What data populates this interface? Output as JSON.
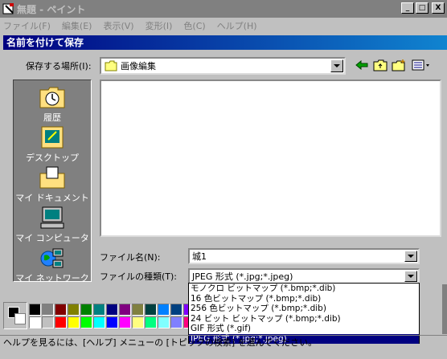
{
  "window": {
    "title": "無題 - ペイント",
    "controls": {
      "minimize": "_",
      "maximize": "□",
      "close": "X"
    }
  },
  "menu": [
    "ファイル(F)",
    "編集(E)",
    "表示(V)",
    "変形(I)",
    "色(C)",
    "ヘルプ(H)"
  ],
  "dialog": {
    "title": "名前を付けて保存",
    "save_in_label": "保存する場所(I):",
    "save_in_value": "画像編集",
    "places": [
      {
        "label": "履歴",
        "icon": "history-icon"
      },
      {
        "label": "デスクトップ",
        "icon": "desktop-icon"
      },
      {
        "label": "マイ ドキュメント",
        "icon": "my-documents-icon"
      },
      {
        "label": "マイ コンピュータ",
        "icon": "my-computer-icon"
      },
      {
        "label": "マイ ネットワーク",
        "icon": "my-network-icon"
      }
    ],
    "filename_label": "ファイル名(N):",
    "filename_value": "城1",
    "filetype_label": "ファイルの種類(T):",
    "filetype_value": "JPEG 形式 (*.jpg;*.jpeg)",
    "filetype_options": [
      "モノクロ ビットマップ (*.bmp;*.dib)",
      "16 色ビットマップ (*.bmp;*.dib)",
      "256 色ビットマップ (*.bmp;*.dib)",
      "24 ビット ビットマップ (*.bmp;*.dib)",
      "GIF 形式 (*.gif)",
      "JPEG 形式 (*.jpg;*.jpeg)"
    ],
    "selected_option_index": 5
  },
  "palette": {
    "top_row": [
      "#000000",
      "#808080",
      "#800000",
      "#808000",
      "#008000",
      "#008080",
      "#000080",
      "#800080",
      "#808040",
      "#004040",
      "#0080ff",
      "#004080",
      "#8000ff",
      "#804000"
    ],
    "bottom_row": [
      "#ffffff",
      "#c0c0c0",
      "#ff0000",
      "#ffff00",
      "#00ff00",
      "#00ffff",
      "#0000ff",
      "#ff00ff",
      "#ffff80",
      "#00ff80",
      "#80ffff",
      "#8080ff",
      "#ff0080",
      "#ff8040"
    ]
  },
  "statusbar": {
    "text": "ヘルプを見るには、[ヘルプ] メニューの [トピックの検索] を選んでください。"
  }
}
